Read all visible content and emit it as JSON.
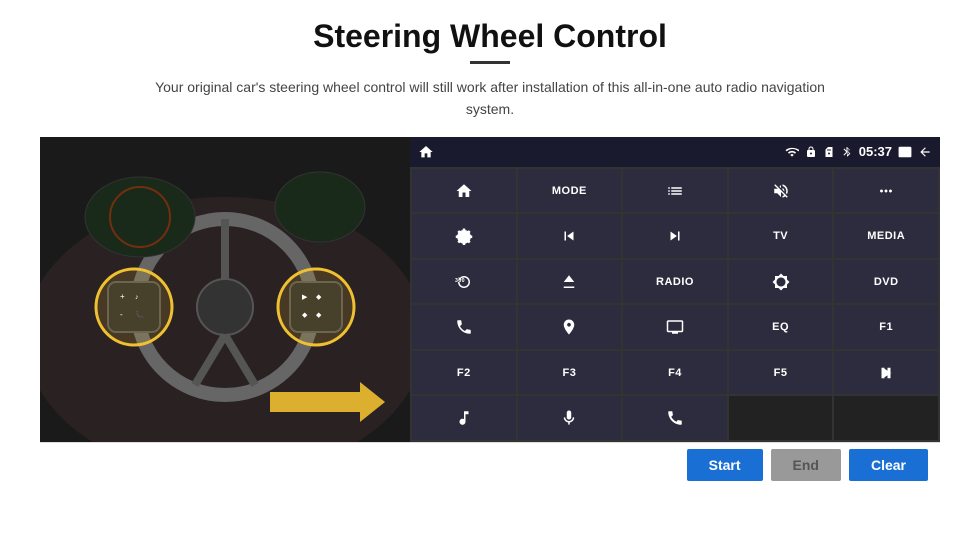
{
  "header": {
    "title": "Steering Wheel Control",
    "subtitle": "Your original car's steering wheel control will still work after installation of this all-in-one auto radio navigation system."
  },
  "statusBar": {
    "time": "05:37",
    "icons": [
      "wifi",
      "lock",
      "sim",
      "bluetooth",
      "display",
      "back"
    ]
  },
  "grid": [
    [
      {
        "type": "icon",
        "icon": "home",
        "label": ""
      },
      {
        "type": "text",
        "label": "MODE"
      },
      {
        "type": "icon",
        "icon": "list",
        "label": ""
      },
      {
        "type": "icon",
        "icon": "mute",
        "label": ""
      },
      {
        "type": "icon",
        "icon": "apps",
        "label": ""
      }
    ],
    [
      {
        "type": "icon",
        "icon": "settings-circle",
        "label": ""
      },
      {
        "type": "icon",
        "icon": "prev",
        "label": ""
      },
      {
        "type": "icon",
        "icon": "next",
        "label": ""
      },
      {
        "type": "text",
        "label": "TV"
      },
      {
        "type": "text",
        "label": "MEDIA"
      }
    ],
    [
      {
        "type": "icon",
        "icon": "360-car",
        "label": ""
      },
      {
        "type": "icon",
        "icon": "eject",
        "label": ""
      },
      {
        "type": "text",
        "label": "RADIO"
      },
      {
        "type": "icon",
        "icon": "brightness",
        "label": ""
      },
      {
        "type": "text",
        "label": "DVD"
      }
    ],
    [
      {
        "type": "icon",
        "icon": "phone",
        "label": ""
      },
      {
        "type": "icon",
        "icon": "nav",
        "label": ""
      },
      {
        "type": "icon",
        "icon": "screen",
        "label": ""
      },
      {
        "type": "text",
        "label": "EQ"
      },
      {
        "type": "text",
        "label": "F1"
      }
    ],
    [
      {
        "type": "text",
        "label": "F2"
      },
      {
        "type": "text",
        "label": "F3"
      },
      {
        "type": "text",
        "label": "F4"
      },
      {
        "type": "text",
        "label": "F5"
      },
      {
        "type": "icon",
        "icon": "play-pause",
        "label": ""
      }
    ],
    [
      {
        "type": "icon",
        "icon": "music",
        "label": ""
      },
      {
        "type": "icon",
        "icon": "mic",
        "label": ""
      },
      {
        "type": "icon",
        "icon": "answer-end",
        "label": ""
      },
      {
        "type": "empty",
        "label": ""
      },
      {
        "type": "empty",
        "label": ""
      }
    ]
  ],
  "bottomBar": {
    "start_label": "Start",
    "end_label": "End",
    "clear_label": "Clear"
  }
}
